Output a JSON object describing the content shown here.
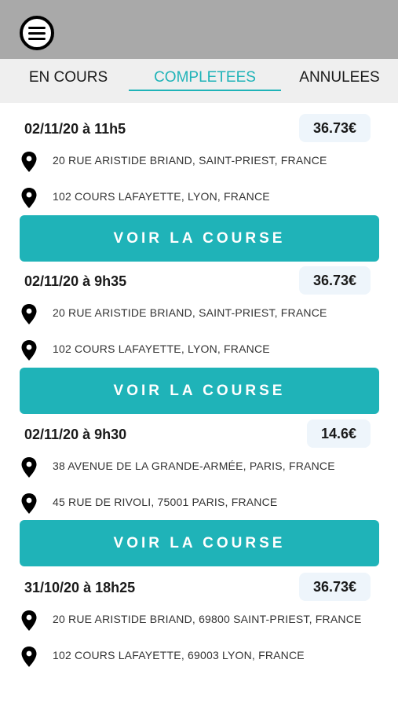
{
  "header": {
    "menu_icon": "hamburger-menu-icon"
  },
  "tabs": [
    {
      "label": "EN COURS",
      "active": false
    },
    {
      "label": "COMPLETEES",
      "active": true
    },
    {
      "label": "ANNULEES",
      "active": false
    }
  ],
  "colors": {
    "accent": "#1fb3b8",
    "topbar": "#a9a9a9",
    "tabbar": "#efefef",
    "price_bg": "#eef5fb"
  },
  "rides": [
    {
      "date": "02/11/20 à 11h5",
      "price": "36.73€",
      "pickup": "20 RUE ARISTIDE BRIAND, SAINT-PRIEST, FRANCE",
      "dropoff": "102 COURS LAFAYETTE, LYON, FRANCE",
      "button_label": "VOIR LA COURSE"
    },
    {
      "date": "02/11/20 à 9h35",
      "price": "36.73€",
      "pickup": "20 RUE ARISTIDE BRIAND, SAINT-PRIEST, FRANCE",
      "dropoff": "102 COURS LAFAYETTE, LYON, FRANCE",
      "button_label": "VOIR LA COURSE"
    },
    {
      "date": "02/11/20 à 9h30",
      "price": "14.6€",
      "pickup": "38 AVENUE DE LA GRANDE-ARMÉE, PARIS, FRANCE",
      "dropoff": "45 RUE DE RIVOLI, 75001 PARIS, FRANCE",
      "button_label": "VOIR LA COURSE"
    },
    {
      "date": "31/10/20 à 18h25",
      "price": "36.73€",
      "pickup": "20 RUE ARISTIDE BRIAND, 69800 SAINT-PRIEST, FRANCE",
      "dropoff": "102 COURS LAFAYETTE, 69003 LYON, FRANCE",
      "button_label": null
    }
  ]
}
